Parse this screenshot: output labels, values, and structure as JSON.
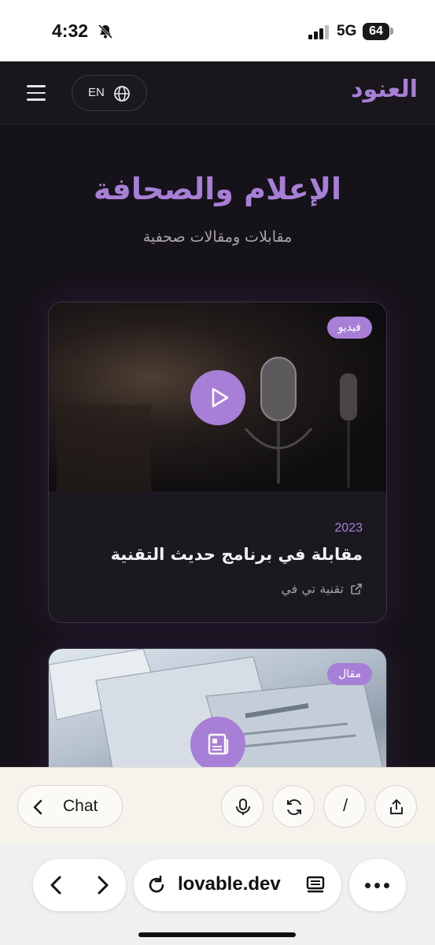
{
  "status_bar": {
    "time": "4:32",
    "network": "5G",
    "battery": "64",
    "icons": [
      "bell-slash-icon",
      "signal-icon",
      "battery-icon"
    ]
  },
  "app": {
    "brand": "العنود",
    "language_button": {
      "label": "EN",
      "icon": "globe-icon"
    },
    "menu_icon": "hamburger-icon",
    "hero": {
      "title": "الإعلام والصحافة",
      "subtitle": "مقابلات ومقالات صحفية"
    },
    "cards": [
      {
        "badge": "فيديو",
        "year": "2023",
        "title": "مقابلة في برنامج حديث التقنية",
        "source": "تقنية تي في",
        "media_icon": "play-icon",
        "source_icon": "external-link-icon"
      },
      {
        "badge": "مقال",
        "media_icon": "newspaper-icon"
      }
    ],
    "colors": {
      "accent": "#a77fd6",
      "background": "#161219",
      "card": "#1c1820"
    }
  },
  "toolbar": {
    "chat_label": "Chat",
    "slash_label": "/",
    "icons": [
      "chevron-left-icon",
      "microphone-icon",
      "refresh-icon",
      "share-icon"
    ]
  },
  "browser": {
    "url": "lovable.dev",
    "icons": [
      "back-icon",
      "forward-icon",
      "reload-icon",
      "reader-icon",
      "more-icon"
    ]
  }
}
